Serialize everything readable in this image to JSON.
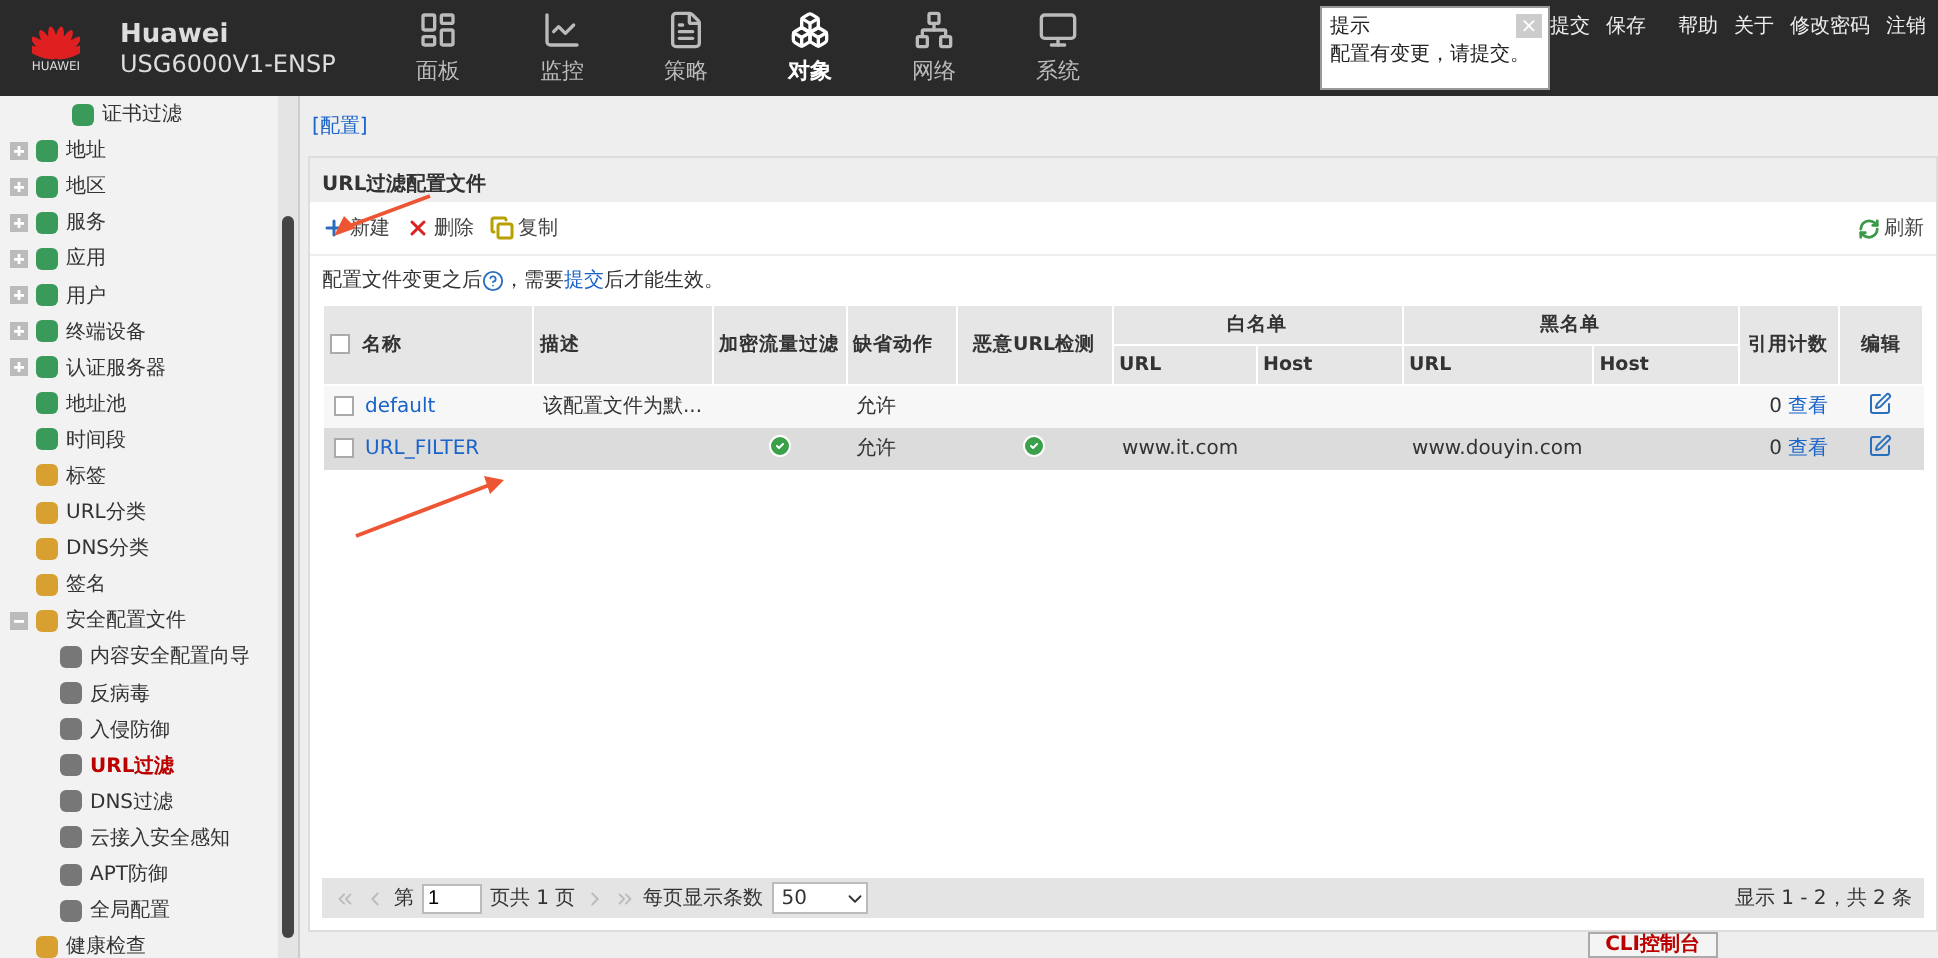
{
  "header": {
    "brand": "HUAWEI",
    "title": "Huawei",
    "device": "USG6000V1-ENSP",
    "nav": [
      {
        "label": "面板",
        "selected": false
      },
      {
        "label": "监控",
        "selected": false
      },
      {
        "label": "策略",
        "selected": false
      },
      {
        "label": "对象",
        "selected": true
      },
      {
        "label": "网络",
        "selected": false
      },
      {
        "label": "系统",
        "selected": false
      }
    ],
    "tip": {
      "title": "提示",
      "close": "×",
      "message": "配置有变更，请提交。"
    },
    "links": [
      {
        "label": "提交",
        "kind": "submit"
      },
      {
        "label": "保存",
        "kind": "plain"
      },
      {
        "label": "帮助",
        "kind": "gap"
      },
      {
        "label": "关于",
        "kind": "plain"
      },
      {
        "label": "修改密码",
        "kind": "plain"
      },
      {
        "label": "注销",
        "kind": "plain"
      }
    ]
  },
  "sidebar": {
    "items": [
      {
        "label": "证书过滤",
        "kind": "sub",
        "selected": false
      },
      {
        "label": "地址",
        "kind": "group",
        "expanded": false,
        "selected": false
      },
      {
        "label": "地区",
        "kind": "group",
        "expanded": false,
        "selected": false
      },
      {
        "label": "服务",
        "kind": "group",
        "expanded": false,
        "selected": false
      },
      {
        "label": "应用",
        "kind": "group",
        "expanded": false,
        "selected": false
      },
      {
        "label": "用户",
        "kind": "group",
        "expanded": false,
        "selected": false
      },
      {
        "label": "终端设备",
        "kind": "group",
        "expanded": false,
        "selected": false
      },
      {
        "label": "认证服务器",
        "kind": "group",
        "expanded": false,
        "selected": false
      },
      {
        "label": "地址池",
        "kind": "leaf",
        "selected": false
      },
      {
        "label": "时间段",
        "kind": "leaf",
        "selected": false
      },
      {
        "label": "标签",
        "kind": "leaf",
        "selected": false
      },
      {
        "label": "URL分类",
        "kind": "leaf",
        "selected": false
      },
      {
        "label": "DNS分类",
        "kind": "leaf",
        "selected": false
      },
      {
        "label": "签名",
        "kind": "leaf",
        "selected": false
      },
      {
        "label": "安全配置文件",
        "kind": "group",
        "expanded": true,
        "selected": false,
        "children": [
          {
            "label": "内容安全配置向导",
            "kind": "sub",
            "selected": false
          },
          {
            "label": "反病毒",
            "kind": "sub",
            "selected": false
          },
          {
            "label": "入侵防御",
            "kind": "sub",
            "selected": false
          },
          {
            "label": "URL过滤",
            "kind": "sub",
            "selected": true
          },
          {
            "label": "DNS过滤",
            "kind": "sub",
            "selected": false
          },
          {
            "label": "云接入安全感知",
            "kind": "sub",
            "selected": false
          },
          {
            "label": "APT防御",
            "kind": "sub",
            "selected": false
          },
          {
            "label": "全局配置",
            "kind": "sub",
            "selected": false
          }
        ]
      },
      {
        "label": "健康检查",
        "kind": "leaf",
        "selected": false
      }
    ]
  },
  "breadcrumb": "[配置]",
  "panel": {
    "title": "URL过滤配置文件",
    "toolbar": [
      {
        "label": "新建",
        "kind": "add"
      },
      {
        "label": "删除",
        "kind": "delete"
      },
      {
        "label": "复制",
        "kind": "copy"
      }
    ],
    "refresh": "刷新",
    "notice": {
      "before": "配置文件变更之后",
      "middle": "，需要",
      "link": "提交",
      "after": "后才能生效。"
    },
    "table": {
      "select_all": false,
      "columns": [
        "名称",
        "描述",
        "加密流量过滤",
        "缺省动作",
        "恶意URL检测",
        "白名单",
        "黑名单",
        "引用计数",
        "编辑"
      ],
      "subcolumns": [
        "URL",
        "Host",
        "URL",
        "Host"
      ],
      "rows": [
        {
          "checked": false,
          "selected": false,
          "name": "default",
          "description": "该配置文件为默...",
          "encrypted": false,
          "action": "允许",
          "malicious_check": false,
          "white_url": "",
          "white_host": "",
          "black_url": "",
          "black_host": "",
          "count": "0",
          "view": "查看"
        },
        {
          "checked": false,
          "selected": true,
          "name": "URL_FILTER",
          "description": "",
          "encrypted": true,
          "action": "允许",
          "malicious_check": true,
          "white_url": "www.it.com",
          "white_host": "",
          "black_url": "www.douyin.com",
          "black_host": "",
          "count": "0",
          "view": "查看"
        }
      ]
    },
    "pager": {
      "page_prefix": "第",
      "page": "1",
      "page_suffix": "页共 1 页",
      "per_page_label": "每页显示条数",
      "per_page": "50",
      "summary": "显示 1 - 2，共 2 条"
    }
  },
  "cli_button": "CLI控制台"
}
